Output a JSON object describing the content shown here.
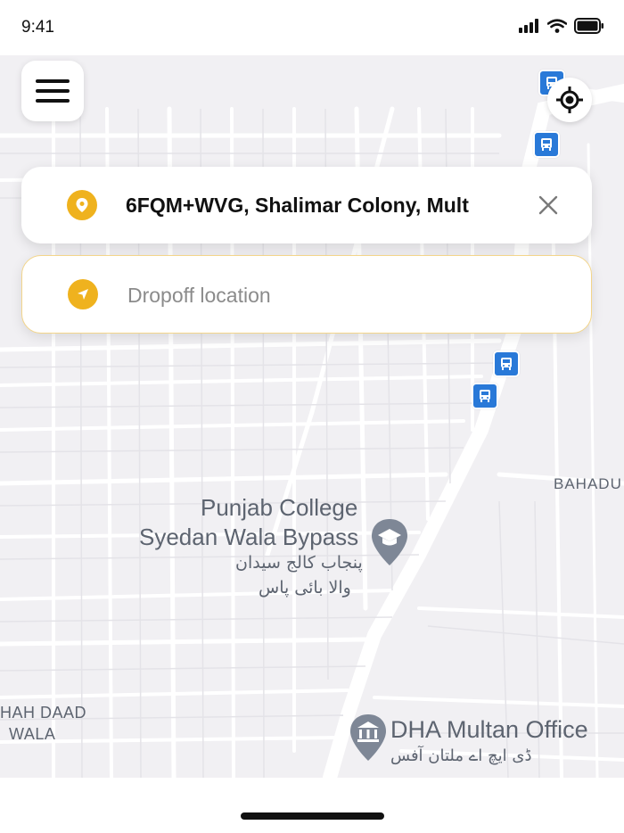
{
  "status_bar": {
    "time": "9:41"
  },
  "icons": {
    "menu": "menu-icon",
    "locate": "crosshair-icon",
    "pickup_pin": "location-pin-icon",
    "dropoff_arrow": "navigation-arrow-icon",
    "clear": "close-icon",
    "bus": "bus-stop-icon",
    "poi_college": "graduation-cap-icon",
    "poi_office": "bank-icon"
  },
  "pickup": {
    "value": "6FQM+WVG, Shalimar Colony, Mult"
  },
  "dropoff": {
    "placeholder": "Dropoff location",
    "value": ""
  },
  "map_labels": {
    "poi_college_line1": "Punjab College",
    "poi_college_line2": "Syedan Wala Bypass",
    "poi_college_urdu1": "پنجاب کالج سیدان",
    "poi_college_urdu2": "والا بائی پاس",
    "poi_office_name": "DHA Multan Office",
    "poi_office_urdu": "ڈی ایچ اے ملتان آفس",
    "area_bahadur": "BAHADU",
    "area_shah_line1": "HAH DAAD",
    "area_shah_line2": "WALA"
  },
  "colors": {
    "accent": "#efb21e",
    "bus": "#2979d8",
    "map_bg": "#f1f0f3",
    "road": "#ffffff",
    "poi_pin": "#7e8796"
  }
}
